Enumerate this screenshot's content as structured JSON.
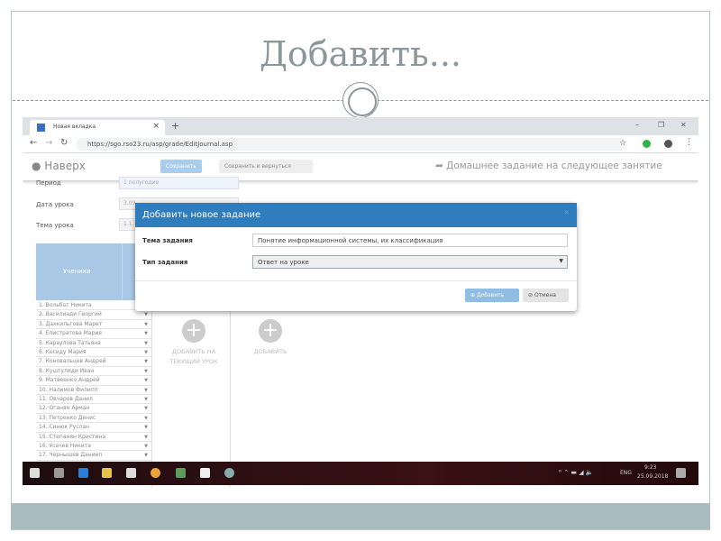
{
  "slide": {
    "title": "Добавить..."
  },
  "browser": {
    "tab_title": "Новая вкладка",
    "url": "https://sgo.rso23.ru/asp/grade/EditJournal.asp",
    "new_tab": "+",
    "tab_close": "×",
    "win_min": "–",
    "win_max": "❐",
    "win_close": "✕"
  },
  "app": {
    "top_link": "Наверх",
    "save": "Сохранить",
    "save_return": "Сохранить и вернуться",
    "homework_link": "Домашнее задание на следующее занятие"
  },
  "form": {
    "period_label": "Период",
    "period_value": "1 полугодие",
    "date_label": "Дата урока",
    "date_value": "3.09",
    "topic_label": "Тема урока",
    "topic_value": "1.1."
  },
  "table": {
    "header": "Ученики",
    "students": [
      "1. Вольбат Никита",
      "2. Василиади Георгий",
      "3. Дахкильгова Марет",
      "4. Елистратова Мария",
      "5. Караулова Татьяна",
      "6. Кесиду Мария",
      "7. Коновальцев Андрей",
      "8. Куштулиди Иван",
      "9. Матвеенко Андрей",
      "10. Налимов Филипп",
      "11. Овчаров Данил",
      "12. Оганян Арман",
      "13. Петренко Денис",
      "14. Синюк Руслан",
      "15. Степанян Кристина",
      "16. Усачев Никита",
      "17. Чернышев Даниил"
    ],
    "add_current": "ДОБАВИТЬ НА ТЕКУЩИЙ УРОК",
    "add": "ДОБАВИТЬ"
  },
  "dialog": {
    "title": "Добавить новое задание",
    "close": "×",
    "topic_label": "Тема задания",
    "topic_value": "Понятие информационной системы, их классификация",
    "type_label": "Тип задания",
    "type_value": "Ответ на уроке",
    "add_button": "Добавить",
    "cancel_button": "Отмена"
  },
  "taskbar": {
    "lang": "ENG",
    "time": "9:23",
    "date": "25.09.2018"
  }
}
